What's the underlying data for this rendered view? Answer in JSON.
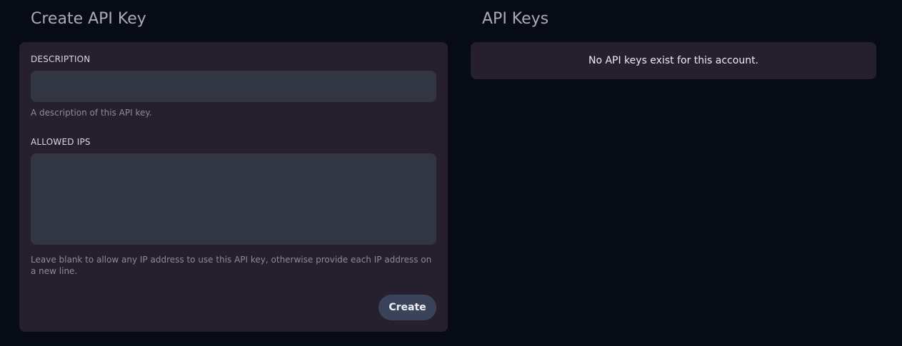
{
  "create_section": {
    "title": "Create API Key",
    "description_field": {
      "label": "DESCRIPTION",
      "value": "",
      "help": "A description of this API key."
    },
    "allowed_ips_field": {
      "label": "ALLOWED IPS",
      "value": "",
      "help": "Leave blank to allow any IP address to use this API key, otherwise provide each IP address on a new line."
    },
    "create_button_label": "Create"
  },
  "keys_section": {
    "title": "API Keys",
    "empty_message": "No API keys exist for this account."
  }
}
